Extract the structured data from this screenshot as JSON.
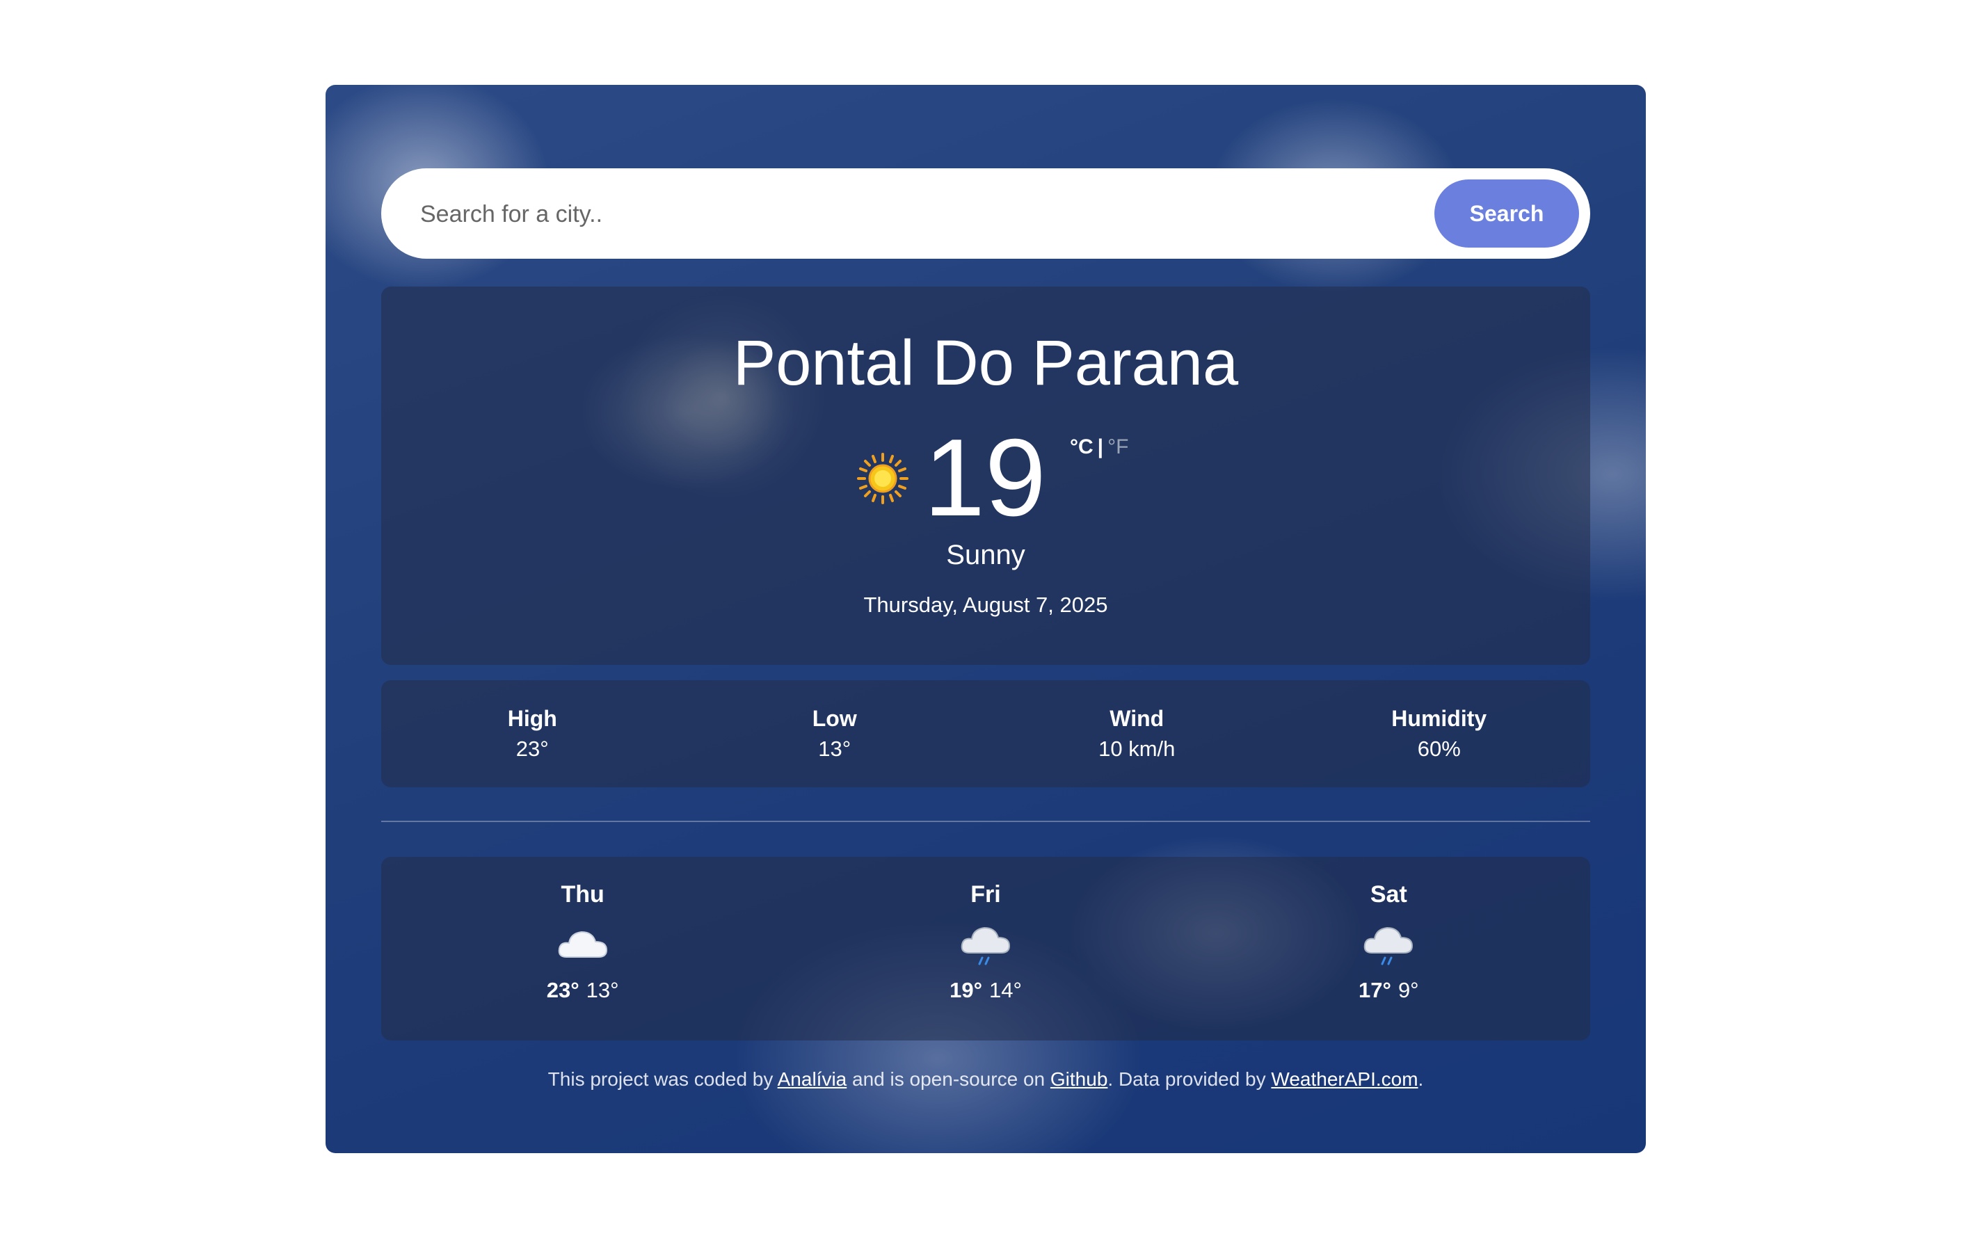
{
  "search": {
    "placeholder": "Search for a city..",
    "button_label": "Search"
  },
  "current": {
    "city": "Pontal Do Parana",
    "icon": "sun-icon",
    "temperature": "19",
    "unit_celsius": "°C",
    "unit_separator": "|",
    "unit_fahrenheit": "°F",
    "condition": "Sunny",
    "date": "Thursday, August 7, 2025"
  },
  "stats": [
    {
      "label": "High",
      "value": "23°"
    },
    {
      "label": "Low",
      "value": "13°"
    },
    {
      "label": "Wind",
      "value": "10 km/h"
    },
    {
      "label": "Humidity",
      "value": "60%"
    }
  ],
  "forecast": [
    {
      "day": "Thu",
      "icon": "cloud-icon",
      "max": "23°",
      "min": "13°"
    },
    {
      "day": "Fri",
      "icon": "cloud-rain-icon",
      "max": "19°",
      "min": "14°"
    },
    {
      "day": "Sat",
      "icon": "cloud-rain-icon",
      "max": "17°",
      "min": "9°"
    }
  ],
  "footer": {
    "text_1": "This project was coded by ",
    "author_link": "Analívia",
    "text_2": " and is open-source on ",
    "github_link": "Github",
    "text_3": ". Data provided by ",
    "api_link": "WeatherAPI.com",
    "text_4": "."
  },
  "colors": {
    "search_button": "#6b80de",
    "background": "#1c3a78"
  }
}
